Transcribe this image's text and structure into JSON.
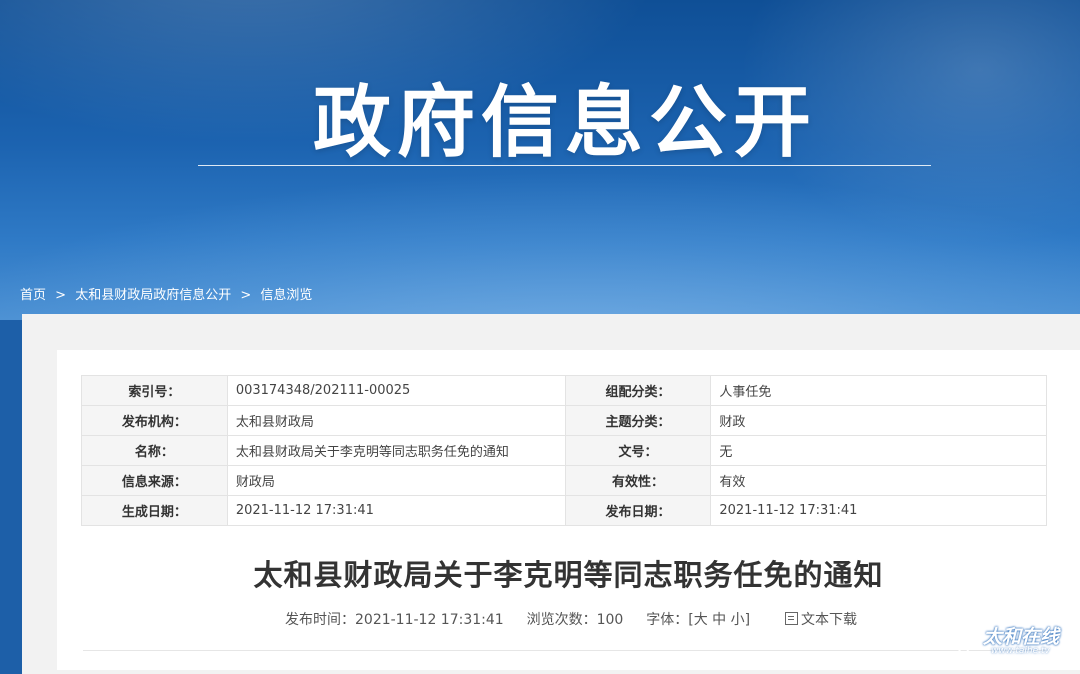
{
  "banner": {
    "title": "政府信息公开"
  },
  "breadcrumb": {
    "home": "首页",
    "section": "太和县财政局政府信息公开",
    "current": "信息浏览",
    "separator": ">"
  },
  "meta_table": {
    "rows": [
      {
        "k1": "索引号：",
        "v1": "003174348/202111-00025",
        "k2": "组配分类：",
        "v2": "人事任免"
      },
      {
        "k1": "发布机构：",
        "v1": "太和县财政局",
        "k2": "主题分类：",
        "v2": "财政"
      },
      {
        "k1": "名称：",
        "v1": "太和县财政局关于李克明等同志职务任免的通知",
        "k2": "文号：",
        "v2": "无"
      },
      {
        "k1": "信息来源：",
        "v1": "财政局",
        "k2": "有效性：",
        "v2": "有效"
      },
      {
        "k1": "生成日期：",
        "v1": "2021-11-12 17:31:41",
        "k2": "发布日期：",
        "v2": "2021-11-12 17:31:41"
      }
    ]
  },
  "document": {
    "title": "太和县财政局关于李克明等同志职务任免的通知",
    "publish_label": "发布时间：",
    "publish_time": "2021-11-12 17:31:41",
    "views_label": "浏览次数：",
    "views": "100",
    "font_label": "字体：[",
    "font_large": "大",
    "font_medium": "中",
    "font_small": "小",
    "font_close": "]",
    "download_label": "文本下载",
    "download_icon": "print-icon"
  },
  "watermark": {
    "text": "太和在线",
    "url": "www.taihe.tv"
  },
  "colors": {
    "banner_dark": "#0f4f96",
    "banner_light": "#4a8fd2",
    "label_bg": "#f5f5f5",
    "border": "#e3e3e3"
  }
}
